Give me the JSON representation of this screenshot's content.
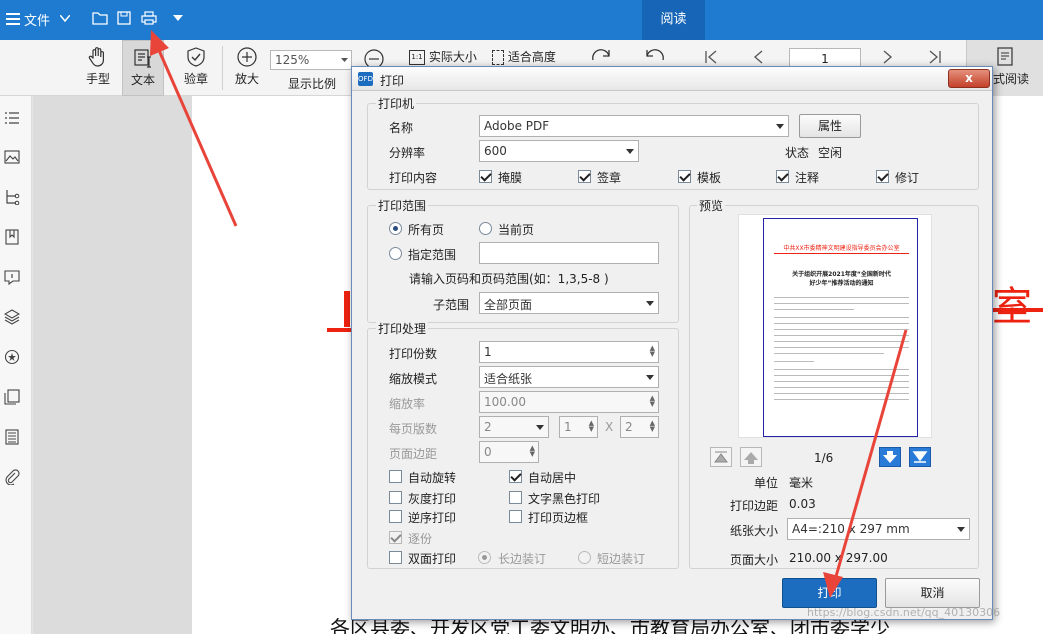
{
  "titlebar": {
    "menu_label": "文件",
    "read_tab": "阅读"
  },
  "toolbar": {
    "hand": "手型",
    "text": "文本",
    "verify": "验章",
    "zoom_in": "放大",
    "zoom_value": "125%",
    "display_ratio": "显示比例",
    "actual_size": "实际大小",
    "fit_height": "适合高度",
    "page_num": "1",
    "read_mode": "模式阅读"
  },
  "document": {
    "red_big_char": "室",
    "body_line": "各区县委、开发区党工委文明办、市教育局办公室、团市委学少"
  },
  "dialog": {
    "title": "打印",
    "close": "x",
    "printer": {
      "group": "打印机",
      "name_label": "名称",
      "name_value": "Adobe PDF",
      "properties": "属性",
      "resolution_label": "分辨率",
      "resolution_value": "600",
      "status_label": "状态",
      "status_value": "空闲",
      "content_label": "打印内容",
      "content": [
        {
          "label": "掩膜",
          "checked": true
        },
        {
          "label": "签章",
          "checked": true
        },
        {
          "label": "模板",
          "checked": true
        },
        {
          "label": "注释",
          "checked": true
        },
        {
          "label": "修订",
          "checked": true
        }
      ]
    },
    "range": {
      "group": "打印范围",
      "all_pages": "所有页",
      "current_page": "当前页",
      "specified": "指定范围",
      "hint": "请输入页码和页码范围(如：1,3,5-8 )",
      "subrange_label": "子范围",
      "subrange_value": "全部页面"
    },
    "processing": {
      "group": "打印处理",
      "copies_label": "打印份数",
      "copies_value": "1",
      "scale_mode_label": "缩放模式",
      "scale_mode_value": "适合纸张",
      "scale_label": "缩放率",
      "scale_value": "100.00",
      "pages_per_sheet_label": "每页版数",
      "pages_per_sheet_value": "2",
      "grid_rows": "1",
      "grid_x": "X",
      "grid_cols": "2",
      "margin_label": "页面边距",
      "margin_value": "0",
      "auto_rotate": "自动旋转",
      "auto_center": "自动居中",
      "grayscale": "灰度打印",
      "text_black": "文字黑色打印",
      "reverse": "逆序打印",
      "print_border": "打印页边框",
      "collate": "逐份",
      "duplex": "双面打印",
      "long_edge": "长边装订",
      "short_edge": "短边装订"
    },
    "preview": {
      "group": "预览",
      "page_indicator": "1/6",
      "unit_label": "单位",
      "unit_value": "毫米",
      "margin_label": "打印边距",
      "margin_value": "0.03",
      "paper_label": "纸张大小",
      "paper_value": "A4=:210 x 297 mm",
      "page_size_label": "页面大小",
      "page_size_value": "210.00 x 297.00",
      "thumb_header": "中共XX市委精神文明建设指导委员会办公室",
      "thumb_title1": "关于组织开展2021年度“全国新时代",
      "thumb_title2": "好少年”推荐活动的通知"
    },
    "print_button": "打印",
    "cancel_button": "取消",
    "watermark": "https://blog.csdn.net/qq_40130306"
  },
  "colors": {
    "titlebar": "#1e7bd0",
    "primary_button": "#1c6cc0",
    "annotation_arrow": "#e8443a"
  }
}
